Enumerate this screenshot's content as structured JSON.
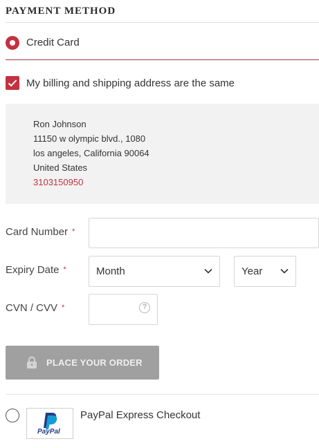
{
  "section": {
    "title": "PAYMENT METHOD"
  },
  "payment_options": {
    "credit_card": {
      "label": "Credit Card",
      "selected": true
    },
    "paypal": {
      "label": "PayPal Express Checkout",
      "selected": false,
      "logo_text": "PayPal"
    }
  },
  "billing": {
    "same_as_shipping_label": "My billing and shipping address are the same",
    "same_as_shipping_checked": true
  },
  "address": {
    "name": "Ron Johnson",
    "street": "11150 w olympic blvd., 1080",
    "city_line": "los angeles, California 90064",
    "country": "United States",
    "phone": "3103150950"
  },
  "form": {
    "card_number": {
      "label": "Card Number",
      "required_mark": "*",
      "value": ""
    },
    "expiry_date": {
      "label": "Expiry Date",
      "required_mark": "*",
      "month_value": "Month",
      "year_value": "Year"
    },
    "cvv": {
      "label": "CVN / CVV",
      "required_mark": "*",
      "value": "",
      "help_glyph": "?"
    }
  },
  "actions": {
    "place_order_label": "PLACE YOUR ORDER"
  },
  "colors": {
    "accent": "#c4323f",
    "button_disabled": "#a0a0a0",
    "address_bg": "#f2f2f2"
  },
  "icons": [
    "checkmark-icon",
    "help-icon",
    "lock-icon",
    "chevron-down-icon",
    "paypal-logo"
  ]
}
